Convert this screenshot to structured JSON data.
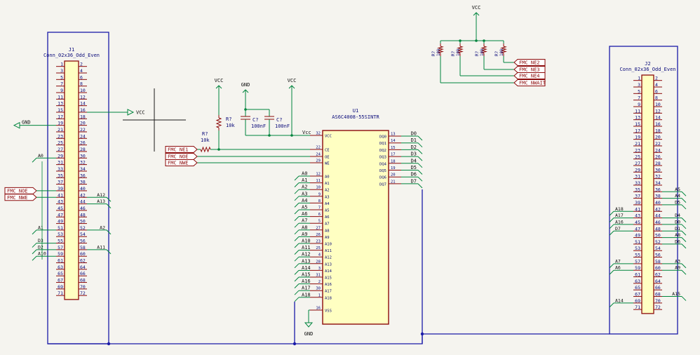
{
  "colors": {
    "background": "#f5f4ef",
    "wire": "#00843d",
    "bus": "#1a1aa8",
    "body_fill": "#ffffc2",
    "body_stroke": "#8c0a0a",
    "pin": "#8c0a0a",
    "text": "#0a0a7a",
    "label_text": "#8c0a0a",
    "netlabel_text": "#0a0a0a"
  },
  "j1": {
    "ref": "J1",
    "value": "Conn_02x36_Odd_Even"
  },
  "j2": {
    "ref": "J2",
    "value": "Conn_02x36_Odd_Even"
  },
  "u1": {
    "ref": "U1",
    "value": "AS6C4008-55SINTR",
    "left_pins": [
      {
        "num": "32",
        "name": "VCC"
      },
      {
        "num": "22",
        "name": "CE"
      },
      {
        "num": "24",
        "name": "OE"
      },
      {
        "num": "29",
        "name": "WE"
      },
      {
        "num": "12",
        "name": "A0"
      },
      {
        "num": "11",
        "name": "A1"
      },
      {
        "num": "10",
        "name": "A2"
      },
      {
        "num": "9",
        "name": "A3"
      },
      {
        "num": "8",
        "name": "A4"
      },
      {
        "num": "7",
        "name": "A5"
      },
      {
        "num": "6",
        "name": "A6"
      },
      {
        "num": "5",
        "name": "A7"
      },
      {
        "num": "27",
        "name": "A8"
      },
      {
        "num": "26",
        "name": "A9"
      },
      {
        "num": "23",
        "name": "A10"
      },
      {
        "num": "25",
        "name": "A11"
      },
      {
        "num": "4",
        "name": "A12"
      },
      {
        "num": "28",
        "name": "A13"
      },
      {
        "num": "3",
        "name": "A14"
      },
      {
        "num": "31",
        "name": "A15"
      },
      {
        "num": "2",
        "name": "A16"
      },
      {
        "num": "30",
        "name": "A17"
      },
      {
        "num": "1",
        "name": "A18"
      },
      {
        "num": "16",
        "name": "VSS"
      }
    ],
    "right_pins": [
      {
        "num": "13",
        "name": "DQ0"
      },
      {
        "num": "14",
        "name": "DQ1"
      },
      {
        "num": "15",
        "name": "DQ2"
      },
      {
        "num": "17",
        "name": "DQ3"
      },
      {
        "num": "18",
        "name": "DQ4"
      },
      {
        "num": "19",
        "name": "DQ5"
      },
      {
        "num": "20",
        "name": "DQ6"
      },
      {
        "num": "21",
        "name": "DQ7"
      }
    ],
    "addr_labels": [
      "A0",
      "A1",
      "A2",
      "A3",
      "A4",
      "A5",
      "A6",
      "A7",
      "A8",
      "A9",
      "A10",
      "A11",
      "A12",
      "A13",
      "A14",
      "A15",
      "A16",
      "A17",
      "A18"
    ],
    "data_labels": [
      "D0",
      "D1",
      "D2",
      "D3",
      "D4",
      "D5",
      "D6",
      "D7"
    ],
    "vcc_label": "Vcc"
  },
  "power": {
    "vcc": "VCC",
    "gnd": "GND"
  },
  "passives": {
    "r_ce": {
      "ref": "R?",
      "value": "10k"
    },
    "r_pu": {
      "ref": "R?",
      "value": "10k"
    },
    "c1": {
      "ref": "C?",
      "value": "100nF"
    },
    "c2": {
      "ref": "C?",
      "value": "100nF"
    },
    "r_top": [
      {
        "ref": "R?",
        "value": "10k"
      },
      {
        "ref": "R?",
        "value": "10k"
      },
      {
        "ref": "R?",
        "value": "10k"
      },
      {
        "ref": "R?",
        "value": "10k"
      }
    ]
  },
  "hier_labels": {
    "ne1": "FMC_NE1",
    "noe_u": "FMC_NOE",
    "nwe_u": "FMC_NWE",
    "noe_j": "FMC_NOE",
    "nwe_j": "FMC_NWE",
    "ne2": "FMC_NE2",
    "ne3": "FMC_NE3",
    "ne4": "FMC_NE4",
    "nwait": "FMC_NWAIT"
  },
  "j1_nets": [
    {
      "pin": 29,
      "side": "L",
      "label": "A0"
    },
    {
      "pin": 42,
      "side": "R",
      "label": "A12"
    },
    {
      "pin": 44,
      "side": "R",
      "label": "A13"
    },
    {
      "pin": 51,
      "side": "L",
      "label": "A1"
    },
    {
      "pin": 52,
      "side": "R",
      "label": "A2"
    },
    {
      "pin": 55,
      "side": "L",
      "label": "D3"
    },
    {
      "pin": 57,
      "side": "L",
      "label": "D2"
    },
    {
      "pin": 58,
      "side": "R",
      "label": "A11"
    },
    {
      "pin": 59,
      "side": "L",
      "label": "A10"
    }
  ],
  "j2_nets": [
    {
      "pin": 36,
      "side": "R",
      "label": "A5"
    },
    {
      "pin": 38,
      "side": "R",
      "label": "A4"
    },
    {
      "pin": 40,
      "side": "R",
      "label": "D5"
    },
    {
      "pin": 41,
      "side": "L",
      "label": "A18"
    },
    {
      "pin": 43,
      "side": "L",
      "label": "A17"
    },
    {
      "pin": 44,
      "side": "R",
      "label": "D4"
    },
    {
      "pin": 45,
      "side": "L",
      "label": "A16"
    },
    {
      "pin": 46,
      "side": "R",
      "label": "D0"
    },
    {
      "pin": 47,
      "side": "L",
      "label": "D7"
    },
    {
      "pin": 48,
      "side": "R",
      "label": "D1"
    },
    {
      "pin": 50,
      "side": "R",
      "label": "A8"
    },
    {
      "pin": 52,
      "side": "R",
      "label": "D6"
    },
    {
      "pin": 57,
      "side": "L",
      "label": "A7"
    },
    {
      "pin": 58,
      "side": "R",
      "label": "A3"
    },
    {
      "pin": 59,
      "side": "L",
      "label": "A6"
    },
    {
      "pin": 60,
      "side": "R",
      "label": "A9"
    },
    {
      "pin": 68,
      "side": "R",
      "label": "A15"
    },
    {
      "pin": 69,
      "side": "L",
      "label": "A14"
    }
  ]
}
